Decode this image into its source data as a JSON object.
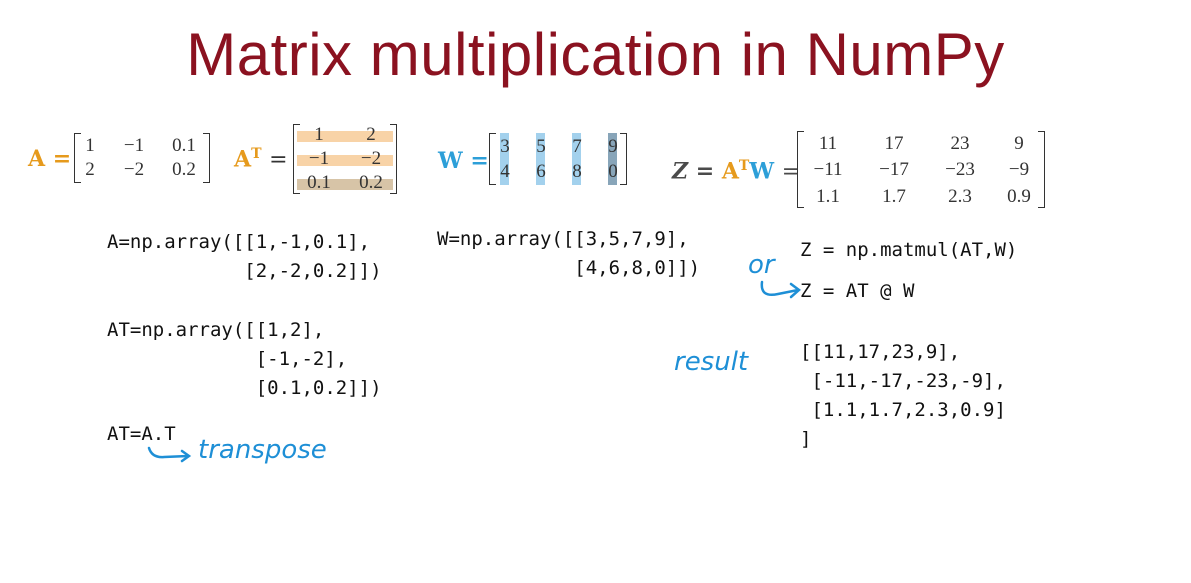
{
  "title": "Matrix multiplication in NumPy",
  "matrices": {
    "A": {
      "label": "A =",
      "rows": [
        [
          "1",
          "−1",
          "0.1"
        ],
        [
          "2",
          "−2",
          "0.2"
        ]
      ]
    },
    "AT": {
      "label": "A",
      "sup": "T",
      "eq": "=",
      "rows": [
        [
          "1",
          "2"
        ],
        [
          "−1",
          "−2"
        ],
        [
          "0.1",
          "0.2"
        ]
      ]
    },
    "W": {
      "label": "W =",
      "rows": [
        [
          "3",
          "5",
          "7",
          "9"
        ],
        [
          "4",
          "6",
          "8",
          "0"
        ]
      ]
    },
    "Z": {
      "label_z": "Z =",
      "label_a": "A",
      "sup": "T",
      "label_w": "W",
      "eq": "=",
      "rows": [
        [
          "11",
          "17",
          "23",
          "9"
        ],
        [
          "−11",
          "−17",
          "−23",
          "−9"
        ],
        [
          "1.1",
          "1.7",
          "2.3",
          "0.9"
        ]
      ]
    }
  },
  "code": {
    "a_array": "A=np.array([[1,-1,0.1],\n            [2,-2,0.2]])",
    "w_array": "W=np.array([[3,5,7,9],\n            [4,6,8,0]])",
    "at_array": "AT=np.array([[1,2],\n             [-1,-2],\n             [0.1,0.2]])",
    "at_transpose": "AT=A.T",
    "matmul": "Z = np.matmul(AT,W)",
    "at_w": "Z = AT @ W",
    "result": "[[11,17,23,9],\n [-11,-17,-23,-9],\n [1.1,1.7,2.3,0.9]\n]"
  },
  "annotations": {
    "transpose": "transpose",
    "or": "or",
    "result": "result"
  },
  "colors": {
    "title": "#8b1220",
    "orange": "#e69a1c",
    "blue": "#2d9fd8",
    "handwriting": "#1e8fd6"
  }
}
